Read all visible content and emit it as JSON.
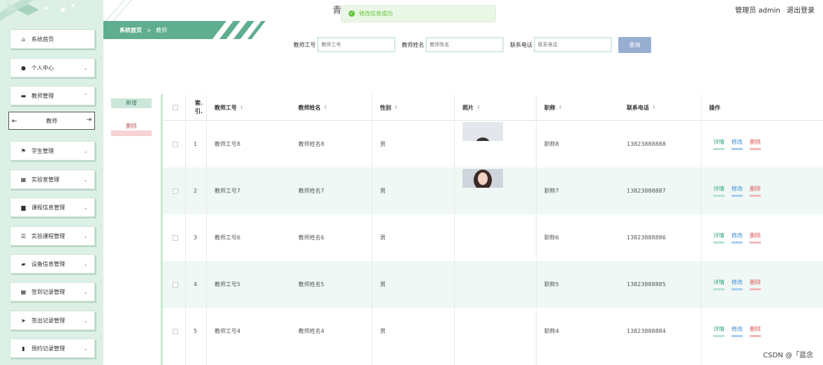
{
  "header": {
    "title_glyph": "青",
    "admin_label": "管理员 admin",
    "logout": "退出登录"
  },
  "toast": {
    "icon": "success-check-icon",
    "text": "修改信息成功"
  },
  "sidebar": {
    "items": [
      {
        "label": "系统首页",
        "icon": "home-icon"
      },
      {
        "label": "个人中心",
        "icon": "user-icon"
      },
      {
        "label": "教师管理",
        "icon": "briefcase-icon"
      },
      {
        "label": "学生管理",
        "icon": "flag-icon"
      },
      {
        "label": "实验室管理",
        "icon": "grid-icon"
      },
      {
        "label": "课程信息管理",
        "icon": "book-icon"
      },
      {
        "label": "实验课程管理",
        "icon": "sliders-icon"
      },
      {
        "label": "设备信息管理",
        "icon": "camera-icon"
      },
      {
        "label": "签到记录管理",
        "icon": "grid-icon"
      },
      {
        "label": "签出记录管理",
        "icon": "send-icon"
      },
      {
        "label": "预约记录管理",
        "icon": "chart-icon"
      }
    ],
    "sub_item": "教师"
  },
  "breadcrumb": {
    "home": "系统首页",
    "sep": ">",
    "current": "教师"
  },
  "search": {
    "no_label": "教师工号",
    "no_placeholder": "教师工号",
    "name_label": "教师姓名",
    "name_placeholder": "教师姓名",
    "phone_label": "联系电话",
    "phone_placeholder": "联系电话",
    "query_button": "查询"
  },
  "actions": {
    "add": "新增",
    "delete": "删除"
  },
  "table": {
    "headers": {
      "index": "索.引.",
      "no": "教师工号",
      "name": "教师姓名",
      "gender": "性别",
      "photo": "照片",
      "title": "职称",
      "phone": "联系电话",
      "ops": "操作"
    },
    "sort_glyph": "⇕",
    "op_labels": {
      "detail": "详情",
      "edit": "修改",
      "delete": "删除"
    },
    "rows": [
      {
        "index": "1",
        "no": "教师工号8",
        "name": "教师姓名8",
        "gender": "男",
        "title": "职称8",
        "phone": "13823888888"
      },
      {
        "index": "2",
        "no": "教师工号7",
        "name": "教师姓名7",
        "gender": "男",
        "title": "职称7",
        "phone": "13823888887"
      },
      {
        "index": "3",
        "no": "教师工号6",
        "name": "教师姓名6",
        "gender": "男",
        "title": "职称6",
        "phone": "13823888886"
      },
      {
        "index": "4",
        "no": "教师工号5",
        "name": "教师姓名5",
        "gender": "男",
        "title": "职称5",
        "phone": "13823888885"
      },
      {
        "index": "5",
        "no": "教师工号4",
        "name": "教师姓名4",
        "gender": "男",
        "title": "职称4",
        "phone": "13823888884"
      }
    ]
  },
  "watermark": "CSDN @「蓝念",
  "colors": {
    "accent": "#5fae8f",
    "sidebar_bg": "#ddf0e6",
    "row_alt": "#eff8f5",
    "query_btn": "#98aed0"
  }
}
